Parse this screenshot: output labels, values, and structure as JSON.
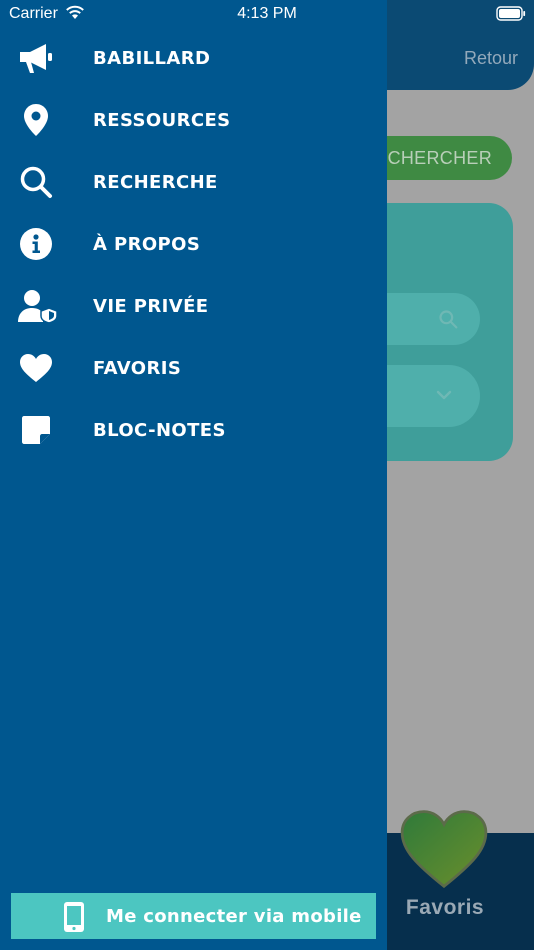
{
  "status_bar": {
    "carrier": "Carrier",
    "time": "4:13 PM"
  },
  "background": {
    "back_label": "Retour",
    "search_button_label": "RECHERCHER",
    "footer_favorites_label": "Favoris"
  },
  "menu": {
    "items": [
      {
        "label": "BABILLARD",
        "icon": "megaphone-icon"
      },
      {
        "label": "RESSOURCES",
        "icon": "map-pin-icon"
      },
      {
        "label": "RECHERCHE",
        "icon": "search-icon"
      },
      {
        "label": "À PROPOS",
        "icon": "info-icon"
      },
      {
        "label": "VIE PRIVÉE",
        "icon": "user-shield-icon"
      },
      {
        "label": "FAVORIS",
        "icon": "heart-icon"
      },
      {
        "label": "BLOC-NOTES",
        "icon": "sticky-note-icon"
      }
    ]
  },
  "mobile_button": {
    "label": "Me connecter via mobile",
    "icon": "phone-icon"
  },
  "colors": {
    "drawer": "#00578f",
    "accent_teal": "#4cc6c1",
    "text": "#ffffff"
  }
}
